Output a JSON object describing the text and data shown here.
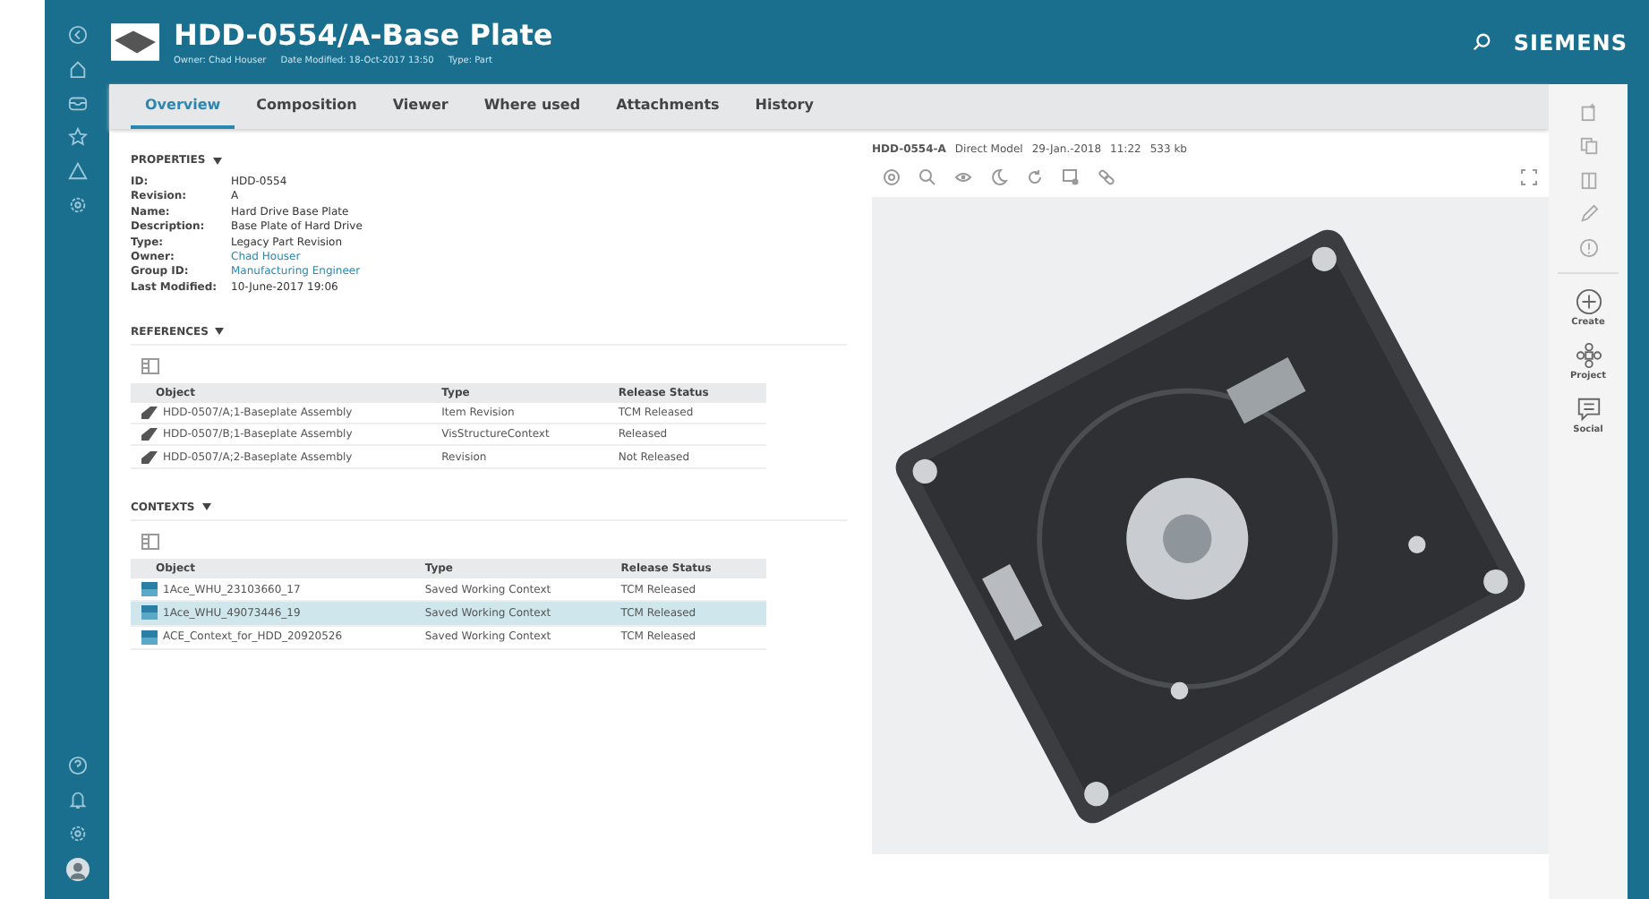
{
  "header": {
    "title": "HDD-0554/A-Base Plate",
    "meta": [
      "Owner: Chad Houser",
      "Date Modified: 18-Oct-2017 13:50",
      "Type: Part"
    ],
    "brand": "SIEMENS"
  },
  "tabs": [
    {
      "label": "Overview",
      "selected": true
    },
    {
      "label": "Composition",
      "selected": false
    },
    {
      "label": "Viewer",
      "selected": false
    },
    {
      "label": "Where used",
      "selected": false
    },
    {
      "label": "Attachments",
      "selected": false
    },
    {
      "label": "History",
      "selected": false
    }
  ],
  "properties": {
    "title": "PROPERTIES",
    "items": [
      {
        "label": "ID:",
        "value": "HDD-0554",
        "kind": "text"
      },
      {
        "label": "Revision:",
        "value": "A",
        "kind": "text"
      },
      {
        "label": "Name:",
        "value": "Hard Drive Base Plate",
        "kind": "text"
      },
      {
        "label": "Description:",
        "value": "Base Plate of Hard Drive",
        "kind": "text"
      },
      {
        "label": "Type:",
        "value": "Legacy Part Revision",
        "kind": "text"
      },
      {
        "label": "Owner:",
        "value": "Chad Houser",
        "kind": "link"
      },
      {
        "label": "Group ID:",
        "value": "Manufacturing Engineer",
        "kind": "link"
      },
      {
        "label": "Last Modified:",
        "value": "10-June-2017 19:06",
        "kind": "text"
      }
    ]
  },
  "tables": [
    {
      "title": "REFERENCES",
      "kind": "reference",
      "columns": [
        "Object",
        "Type",
        "Release Status"
      ],
      "rows": [
        {
          "cells": [
            "HDD-0507/A;1-Baseplate Assembly",
            "Item Revision",
            "TCM Released"
          ],
          "selected": false
        },
        {
          "cells": [
            "HDD-0507/B;1-Baseplate Assembly",
            "VisStructureContext",
            "Released"
          ],
          "selected": false
        },
        {
          "cells": [
            "HDD-0507/A;2-Baseplate Assembly",
            "Revision",
            "Not Released"
          ],
          "selected": false
        }
      ]
    },
    {
      "title": "CONTEXTS",
      "kind": "context",
      "columns": [
        "Object",
        "Type",
        "Release Status"
      ],
      "rows": [
        {
          "cells": [
            "1Ace_WHU_23103660_17",
            "Saved Working Context",
            "TCM Released"
          ],
          "selected": false
        },
        {
          "cells": [
            "1Ace_WHU_49073446_19",
            "Saved Working Context",
            "TCM Released"
          ],
          "selected": true
        },
        {
          "cells": [
            "ACE_Context_for_HDD_20920526",
            "Saved Working Context",
            "TCM Released"
          ],
          "selected": false
        }
      ]
    }
  ],
  "viewer": {
    "name": "HDD-0554-A",
    "info": [
      "Direct Model",
      "29-Jan.-2018",
      "11:22",
      "533 kb"
    ]
  },
  "right_toolbar": [
    "Create",
    "Project",
    "Social"
  ]
}
